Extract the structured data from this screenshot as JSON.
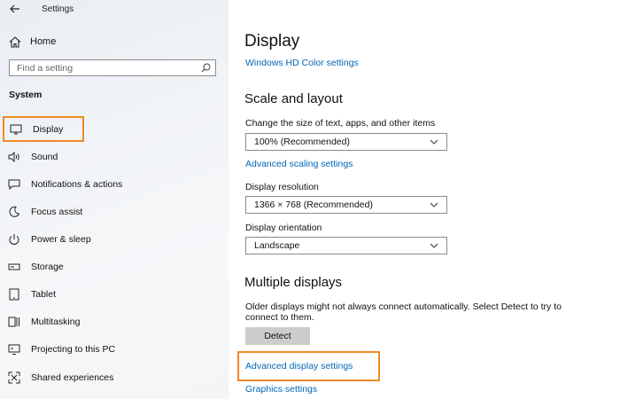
{
  "window": {
    "title": "Settings"
  },
  "sidebar": {
    "home_label": "Home",
    "search_placeholder": "Find a setting",
    "section_label": "System",
    "items": [
      {
        "label": "Display",
        "icon": "monitor-icon",
        "selected": true
      },
      {
        "label": "Sound",
        "icon": "speaker-icon"
      },
      {
        "label": "Notifications & actions",
        "icon": "notification-icon"
      },
      {
        "label": "Focus assist",
        "icon": "moon-icon"
      },
      {
        "label": "Power & sleep",
        "icon": "power-icon"
      },
      {
        "label": "Storage",
        "icon": "storage-icon"
      },
      {
        "label": "Tablet",
        "icon": "tablet-icon"
      },
      {
        "label": "Multitasking",
        "icon": "multitasking-icon"
      },
      {
        "label": "Projecting to this PC",
        "icon": "projector-icon"
      },
      {
        "label": "Shared experiences",
        "icon": "shared-icon"
      }
    ]
  },
  "main": {
    "title": "Display",
    "hd_color_link": "Windows HD Color settings",
    "scale_heading": "Scale and layout",
    "scale_label": "Change the size of text, apps, and other items",
    "scale_value": "100% (Recommended)",
    "advanced_scaling_link": "Advanced scaling settings",
    "resolution_label": "Display resolution",
    "resolution_value": "1366 × 768 (Recommended)",
    "orientation_label": "Display orientation",
    "orientation_value": "Landscape",
    "multiple_heading": "Multiple displays",
    "multiple_text": "Older displays might not always connect automatically. Select Detect to try to connect to them.",
    "detect_button": "Detect",
    "advanced_display_link": "Advanced display settings",
    "graphics_link": "Graphics settings"
  },
  "colors": {
    "accent": "#0067b8",
    "highlight": "#f08a24"
  }
}
